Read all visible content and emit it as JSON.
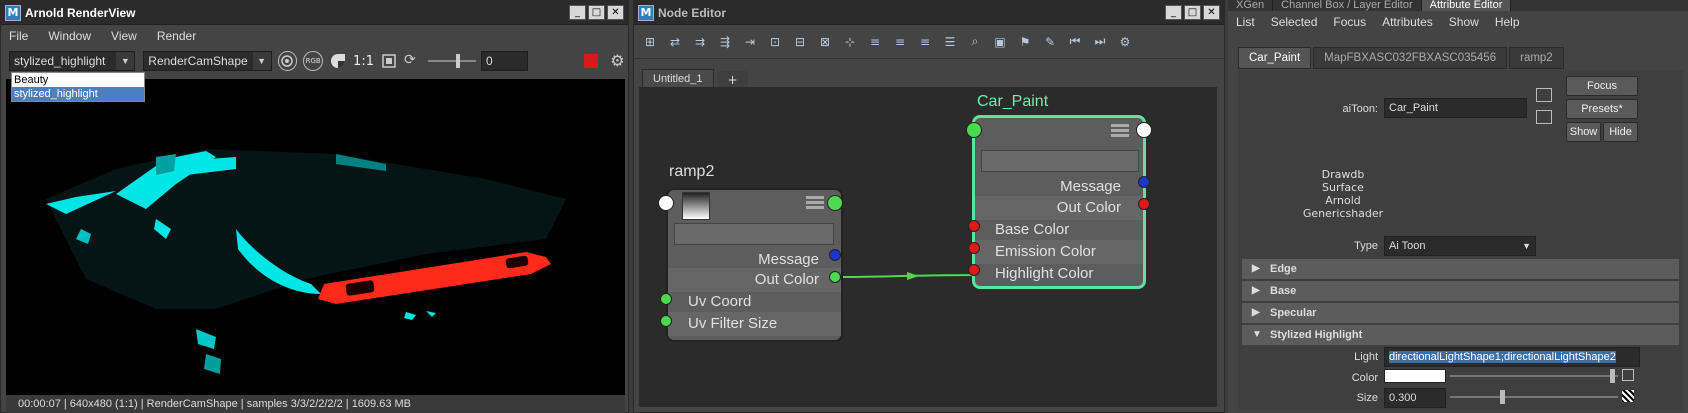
{
  "renderview": {
    "title": "Arnold RenderView",
    "menu": [
      "File",
      "Window",
      "View",
      "Render"
    ],
    "aov_selected": "stylized_highlight",
    "aov_options": [
      "Beauty",
      "stylized_highlight"
    ],
    "camera": "RenderCamShape",
    "rgb_label": "RGB",
    "ratio": "1:1",
    "exposure_value": "0",
    "status": "00:00:07 | 640x480 (1:1) | RenderCamShape  | samples 3/3/2/2/2/2 | 1609.63 MB"
  },
  "node_editor": {
    "title": "Node Editor",
    "tab": "Untitled_1",
    "add_tab": "+",
    "ramp_node": {
      "name": "ramp2",
      "attrs": [
        "Message",
        "Out Color",
        "Uv Coord",
        "Uv Filter Size"
      ]
    },
    "car_node": {
      "name": "Car_Paint",
      "attrs": [
        "Message",
        "Out Color",
        "Base Color",
        "Emission Color",
        "Highlight Color"
      ]
    }
  },
  "attr_editor": {
    "top_tabs": [
      "XGen",
      "Channel Box / Layer Editor",
      "Attribute Editor"
    ],
    "menu": [
      "List",
      "Selected",
      "Focus",
      "Attributes",
      "Show",
      "Help"
    ],
    "node_tabs": [
      "Car_Paint",
      "MapFBXASC032FBXASC035456",
      "ramp2"
    ],
    "type_label": "aiToon:",
    "node_name": "Car_Paint",
    "focus_btn": "Focus",
    "presets_btn": "Presets*",
    "show_btn": "Show",
    "hide_btn": "Hide",
    "classification": [
      "Drawdb",
      "Surface",
      "Arnold",
      "Genericshader"
    ],
    "type_field_label": "Type",
    "type_value": "Ai Toon",
    "sections": [
      "Edge",
      "Base",
      "Specular",
      "Stylized Highlight"
    ],
    "light_label": "Light",
    "light_value": "directionalLightShape1;directionalLightShape2",
    "color_label": "Color",
    "size_label": "Size",
    "size_value": "0.300"
  },
  "colors": {
    "cyan_highlight": "#00e5e5",
    "red_taillight": "#ff2a1a",
    "selected_node_border": "#5fe1a0",
    "port_green": "#4dd84d",
    "port_red": "#e01818",
    "port_blue": "#1d35c8"
  }
}
